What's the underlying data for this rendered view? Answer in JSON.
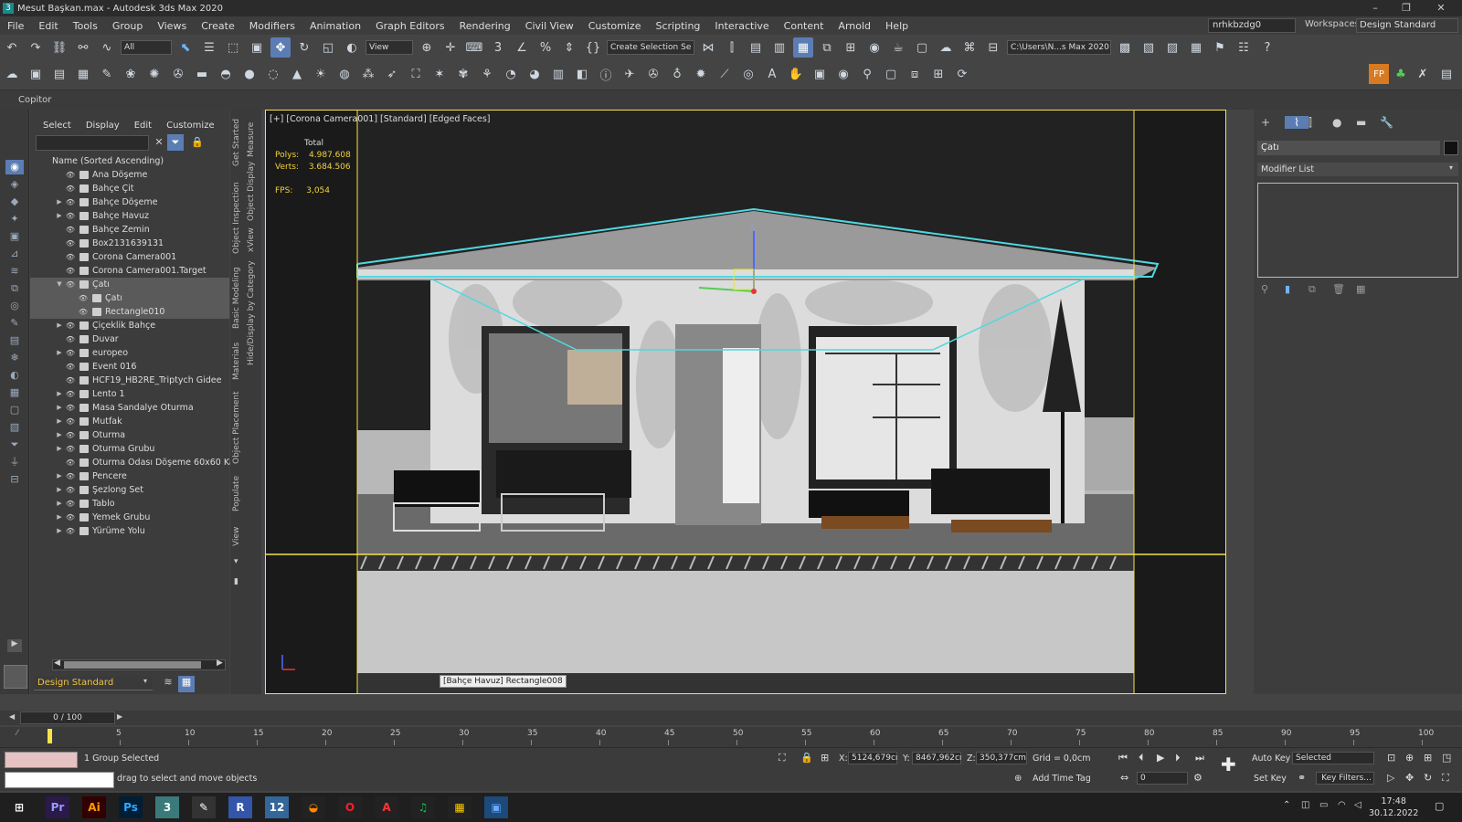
{
  "window": {
    "title": "Mesut Başkan.max - Autodesk 3ds Max 2020"
  },
  "menu": [
    "File",
    "Edit",
    "Tools",
    "Group",
    "Views",
    "Create",
    "Modifiers",
    "Animation",
    "Graph Editors",
    "Rendering",
    "Civil View",
    "Customize",
    "Scripting",
    "Interactive",
    "Content",
    "Arnold",
    "Help"
  ],
  "account": {
    "user": "nrhkbzdg0",
    "workspaces_label": "Workspaces:",
    "workspace": "Design Standard"
  },
  "toolbar": {
    "filter": "All",
    "refcoord": "View",
    "selection_set": "Create Selection Se",
    "path": "C:\\Users\\N...s Max 2020"
  },
  "ribbon": {
    "label": "Copitor"
  },
  "explorer": {
    "tabs": [
      "Select",
      "Display",
      "Edit",
      "Customize"
    ],
    "column_header": "Name (Sorted Ascending)",
    "items": [
      {
        "name": "Ana Döşeme",
        "level": 0,
        "arrow": ""
      },
      {
        "name": "Bahçe Çit",
        "level": 0,
        "arrow": ""
      },
      {
        "name": "Bahçe Döşeme",
        "level": 0,
        "arrow": "▶"
      },
      {
        "name": "Bahçe Havuz",
        "level": 0,
        "arrow": "▶"
      },
      {
        "name": "Bahçe Zemin",
        "level": 0,
        "arrow": ""
      },
      {
        "name": "Box2131639131",
        "level": 0,
        "arrow": ""
      },
      {
        "name": "Corona Camera001",
        "level": 0,
        "arrow": ""
      },
      {
        "name": "Corona Camera001.Target",
        "level": 0,
        "arrow": ""
      },
      {
        "name": "Çatı",
        "level": 0,
        "arrow": "▼",
        "selected": true
      },
      {
        "name": "Çatı",
        "level": 1,
        "arrow": "",
        "selected": true
      },
      {
        "name": "Rectangle010",
        "level": 1,
        "arrow": "",
        "selected": true
      },
      {
        "name": "Çiçeklik Bahçe",
        "level": 0,
        "arrow": "▶"
      },
      {
        "name": "Duvar",
        "level": 0,
        "arrow": ""
      },
      {
        "name": "europeo",
        "level": 0,
        "arrow": "▶"
      },
      {
        "name": "Event 016",
        "level": 0,
        "arrow": ""
      },
      {
        "name": "HCF19_HB2RE_Triptych Gidee",
        "level": 0,
        "arrow": ""
      },
      {
        "name": "Lento 1",
        "level": 0,
        "arrow": "▶"
      },
      {
        "name": "Masa  Sandalye Oturma",
        "level": 0,
        "arrow": "▶"
      },
      {
        "name": "Mutfak",
        "level": 0,
        "arrow": "▶"
      },
      {
        "name": "Oturma",
        "level": 0,
        "arrow": "▶"
      },
      {
        "name": "Oturma Grubu",
        "level": 0,
        "arrow": "▶"
      },
      {
        "name": "Oturma Odası Döşeme 60x60 Karo",
        "level": 0,
        "arrow": ""
      },
      {
        "name": "Pencere",
        "level": 0,
        "arrow": "▶"
      },
      {
        "name": "Şezlong Set",
        "level": 0,
        "arrow": "▶"
      },
      {
        "name": "Tablo",
        "level": 0,
        "arrow": "▶"
      },
      {
        "name": "Yemek Grubu",
        "level": 0,
        "arrow": "▶"
      },
      {
        "name": "Yürüme Yolu",
        "level": 0,
        "arrow": "▶"
      }
    ],
    "workspace_selector": "Design Standard"
  },
  "side_tabs": [
    "Get Started",
    "Object Inspection",
    "Basic Modeling",
    "Materials",
    "Object Placement",
    "Populate",
    "View",
    "Measure",
    "Object Display",
    "xView",
    "Hide/Display by Category"
  ],
  "viewport": {
    "label": "[+] [Corona Camera001] [Standard] [Edged Faces]",
    "stats": {
      "total_label": "Total",
      "polys_label": "Polys:",
      "polys": "4.987.608",
      "verts_label": "Verts:",
      "verts": "3.684.506",
      "fps_label": "FPS:",
      "fps": "3,054"
    },
    "tooltip": "[Bahçe Havuz] Rectangle008"
  },
  "command_panel": {
    "object_name": "Çatı",
    "modifier_list": "Modifier List"
  },
  "timeline": {
    "frame": "0 / 100",
    "ticks": [
      "0",
      "5",
      "10",
      "15",
      "20",
      "25",
      "30",
      "35",
      "40",
      "45",
      "50",
      "55",
      "60",
      "65",
      "70",
      "75",
      "80",
      "85",
      "90",
      "95",
      "100"
    ]
  },
  "status": {
    "selection": "1 Group Selected",
    "prompt": "drag to select and move objects",
    "x_label": "X:",
    "x": "5124,679cı",
    "y_label": "Y:",
    "y": "8467,962cı",
    "z_label": "Z:",
    "z": "350,377cm",
    "grid": "Grid = 0,0cm",
    "add_time_tag": "Add Time Tag",
    "auto_key": "Auto Key",
    "set_key": "Set Key",
    "key_mode": "Selected",
    "key_filters": "Key Filters...",
    "frame_field": "0"
  },
  "taskbar": {
    "apps": [
      {
        "label": "Pr",
        "color": "#9999ff",
        "bg": "#2a1a4a"
      },
      {
        "label": "Ai",
        "color": "#ff9a00",
        "bg": "#330000"
      },
      {
        "label": "Ps",
        "color": "#31a8ff",
        "bg": "#001e36"
      },
      {
        "label": "3",
        "color": "#ffffff",
        "bg": "#3a7a7a"
      },
      {
        "label": "✎",
        "color": "#ffffff",
        "bg": "#333333"
      },
      {
        "label": "R",
        "color": "#ffffff",
        "bg": "#3355aa"
      },
      {
        "label": "12",
        "color": "#ffffff",
        "bg": "#336699"
      },
      {
        "label": "◒",
        "color": "#ff8a00",
        "bg": "#222222"
      },
      {
        "label": "O",
        "color": "#ff1b2d",
        "bg": "#222222"
      },
      {
        "label": "A",
        "color": "#ff3333",
        "bg": "#222222"
      },
      {
        "label": "♫",
        "color": "#1db954",
        "bg": "#222222"
      },
      {
        "label": "▦",
        "color": "#ffcc00",
        "bg": "#222222"
      },
      {
        "label": "▣",
        "color": "#66aaff",
        "bg": "#1c4a7a"
      }
    ],
    "time": "17:48",
    "date": "30.12.2022"
  },
  "colors": {
    "accent": "#5b7db3",
    "viewport_border": "#f4e34a",
    "stats": "#f4d23a",
    "selection_box": "#4fd8e0"
  }
}
